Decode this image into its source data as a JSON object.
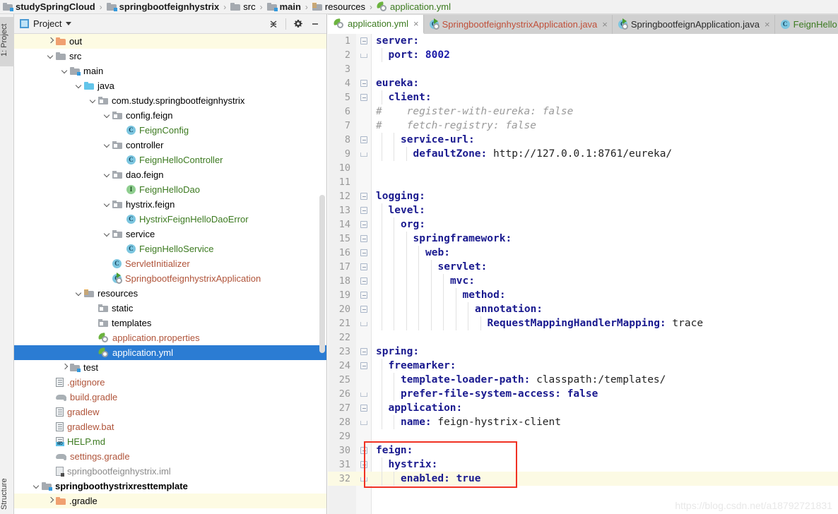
{
  "breadcrumb": {
    "items": [
      {
        "label": "studySpringCloud",
        "icon": "module-folder-icon",
        "style": "bold"
      },
      {
        "label": "springbootfeignhystrix",
        "icon": "module-folder-icon",
        "style": "bold"
      },
      {
        "label": "src",
        "icon": "folder-icon",
        "style": "normal"
      },
      {
        "label": "main",
        "icon": "source-folder-icon",
        "style": "bold"
      },
      {
        "label": "resources",
        "icon": "resources-folder-icon",
        "style": "normal"
      },
      {
        "label": "application.yml",
        "icon": "yaml-file-icon",
        "style": "green"
      }
    ]
  },
  "left_strip": {
    "project_tab": "1: Project",
    "structure_tab": "Structure"
  },
  "project_panel": {
    "title": "Project",
    "toolbar": {
      "collapse_all": "collapse-all-icon",
      "settings": "gear-icon",
      "hide": "minimize-icon"
    },
    "tree": [
      {
        "label": "out",
        "depth": 2,
        "arrow": "right",
        "icon": "folder-orange-icon",
        "color": "default",
        "state": "excluded"
      },
      {
        "label": "src",
        "depth": 2,
        "arrow": "down",
        "icon": "folder-icon",
        "color": "default"
      },
      {
        "label": "main",
        "depth": 3,
        "arrow": "down",
        "icon": "source-folder-icon",
        "color": "default"
      },
      {
        "label": "java",
        "depth": 4,
        "arrow": "down",
        "icon": "folder-blue-icon",
        "color": "default"
      },
      {
        "label": "com.study.springbootfeignhystrix",
        "depth": 5,
        "arrow": "down",
        "icon": "package-icon",
        "color": "default"
      },
      {
        "label": "config.feign",
        "depth": 6,
        "arrow": "down",
        "icon": "package-icon",
        "color": "default"
      },
      {
        "label": "FeignConfig",
        "depth": 7,
        "arrow": "none",
        "icon": "java-class-icon",
        "color": "green"
      },
      {
        "label": "controller",
        "depth": 6,
        "arrow": "down",
        "icon": "package-icon",
        "color": "default"
      },
      {
        "label": "FeignHelloController",
        "depth": 7,
        "arrow": "none",
        "icon": "java-class-icon",
        "color": "green"
      },
      {
        "label": "dao.feign",
        "depth": 6,
        "arrow": "down",
        "icon": "package-icon",
        "color": "default"
      },
      {
        "label": "FeignHelloDao",
        "depth": 7,
        "arrow": "none",
        "icon": "java-interface-icon",
        "color": "green"
      },
      {
        "label": "hystrix.feign",
        "depth": 6,
        "arrow": "down",
        "icon": "package-icon",
        "color": "default"
      },
      {
        "label": "HystrixFeignHelloDaoError",
        "depth": 7,
        "arrow": "none",
        "icon": "java-class-icon",
        "color": "green"
      },
      {
        "label": "service",
        "depth": 6,
        "arrow": "down",
        "icon": "package-icon",
        "color": "default"
      },
      {
        "label": "FeignHelloService",
        "depth": 7,
        "arrow": "none",
        "icon": "java-class-icon",
        "color": "green"
      },
      {
        "label": "ServletInitializer",
        "depth": 6,
        "arrow": "none",
        "icon": "java-class-icon",
        "color": "red"
      },
      {
        "label": "SpringbootfeignhystrixApplication",
        "depth": 6,
        "arrow": "none",
        "icon": "spring-boot-class-icon",
        "color": "red"
      },
      {
        "label": "resources",
        "depth": 4,
        "arrow": "down",
        "icon": "resources-folder-icon",
        "color": "default"
      },
      {
        "label": "static",
        "depth": 5,
        "arrow": "none",
        "icon": "package-icon",
        "color": "default"
      },
      {
        "label": "templates",
        "depth": 5,
        "arrow": "none",
        "icon": "package-icon",
        "color": "default"
      },
      {
        "label": "application.properties",
        "depth": 5,
        "arrow": "none",
        "icon": "yaml-file-icon",
        "color": "red"
      },
      {
        "label": "application.yml",
        "depth": 5,
        "arrow": "none",
        "icon": "yaml-file-icon",
        "color": "default",
        "state": "selected"
      },
      {
        "label": "test",
        "depth": 3,
        "arrow": "right",
        "icon": "source-folder-icon",
        "color": "default"
      },
      {
        "label": ".gitignore",
        "depth": 2,
        "arrow": "none",
        "icon": "text-file-icon",
        "color": "red"
      },
      {
        "label": "build.gradle",
        "depth": 2,
        "arrow": "none",
        "icon": "gradle-file-icon",
        "color": "red"
      },
      {
        "label": "gradlew",
        "depth": 2,
        "arrow": "none",
        "icon": "text-file-icon",
        "color": "red"
      },
      {
        "label": "gradlew.bat",
        "depth": 2,
        "arrow": "none",
        "icon": "text-file-icon",
        "color": "red"
      },
      {
        "label": "HELP.md",
        "depth": 2,
        "arrow": "none",
        "icon": "markdown-file-icon",
        "color": "green"
      },
      {
        "label": "settings.gradle",
        "depth": 2,
        "arrow": "none",
        "icon": "gradle-file-icon",
        "color": "red"
      },
      {
        "label": "springbootfeignhystrix.iml",
        "depth": 2,
        "arrow": "none",
        "icon": "iml-file-icon",
        "color": "grey"
      },
      {
        "label": "springboothystrixresttemplate",
        "depth": 1,
        "arrow": "down",
        "icon": "module-folder-icon",
        "color": "default",
        "bold": true
      },
      {
        "label": ".gradle",
        "depth": 2,
        "arrow": "right",
        "icon": "folder-orange-icon",
        "color": "default",
        "state": "excluded"
      }
    ]
  },
  "editor": {
    "tabs": [
      {
        "label": "application.yml",
        "icon": "yaml-file-icon",
        "color": "green",
        "active": true,
        "closable": true
      },
      {
        "label": "SpringbootfeignhystrixApplication.java",
        "icon": "spring-boot-class-icon",
        "color": "red",
        "active": false,
        "closable": true
      },
      {
        "label": "SpringbootfeignApplication.java",
        "icon": "spring-boot-class-icon",
        "color": "dark",
        "active": false,
        "closable": true
      },
      {
        "label": "FeignHello",
        "icon": "java-class-icon",
        "color": "green",
        "active": false,
        "closable": false
      }
    ],
    "file": "application.yml",
    "current_line": 32,
    "lines": [
      {
        "n": 1,
        "indent": 0,
        "tokens": [
          {
            "t": "server:",
            "c": "k"
          }
        ],
        "fold": "start"
      },
      {
        "n": 2,
        "indent": 1,
        "tokens": [
          {
            "t": "port: ",
            "c": "k"
          },
          {
            "t": "8002",
            "c": "num"
          }
        ],
        "fold": "end"
      },
      {
        "n": 3,
        "indent": 0,
        "tokens": []
      },
      {
        "n": 4,
        "indent": 0,
        "tokens": [
          {
            "t": "eureka:",
            "c": "k"
          }
        ],
        "fold": "start"
      },
      {
        "n": 5,
        "indent": 1,
        "tokens": [
          {
            "t": "client:",
            "c": "k"
          }
        ],
        "fold": "start"
      },
      {
        "n": 6,
        "indent": 0,
        "tokens": [
          {
            "t": "#    register-with-eureka: false",
            "c": "cm"
          }
        ]
      },
      {
        "n": 7,
        "indent": 0,
        "tokens": [
          {
            "t": "#    fetch-registry: false",
            "c": "cm"
          }
        ]
      },
      {
        "n": 8,
        "indent": 2,
        "tokens": [
          {
            "t": "service-url:",
            "c": "k"
          }
        ],
        "fold": "start"
      },
      {
        "n": 9,
        "indent": 3,
        "tokens": [
          {
            "t": "defaultZone: ",
            "c": "k"
          },
          {
            "t": "http://127.0.0.1:8761/eureka/",
            "c": "plain"
          }
        ],
        "fold": "end"
      },
      {
        "n": 10,
        "indent": 0,
        "tokens": []
      },
      {
        "n": 11,
        "indent": 0,
        "tokens": []
      },
      {
        "n": 12,
        "indent": 0,
        "tokens": [
          {
            "t": "logging:",
            "c": "k"
          }
        ],
        "fold": "start"
      },
      {
        "n": 13,
        "indent": 1,
        "tokens": [
          {
            "t": "level:",
            "c": "k"
          }
        ],
        "fold": "start"
      },
      {
        "n": 14,
        "indent": 2,
        "tokens": [
          {
            "t": "org:",
            "c": "k"
          }
        ],
        "fold": "start"
      },
      {
        "n": 15,
        "indent": 3,
        "tokens": [
          {
            "t": "springframework:",
            "c": "k"
          }
        ],
        "fold": "start"
      },
      {
        "n": 16,
        "indent": 4,
        "tokens": [
          {
            "t": "web:",
            "c": "k"
          }
        ],
        "fold": "start"
      },
      {
        "n": 17,
        "indent": 5,
        "tokens": [
          {
            "t": "servlet:",
            "c": "k"
          }
        ],
        "fold": "start"
      },
      {
        "n": 18,
        "indent": 6,
        "tokens": [
          {
            "t": "mvc:",
            "c": "k"
          }
        ],
        "fold": "start"
      },
      {
        "n": 19,
        "indent": 7,
        "tokens": [
          {
            "t": "method:",
            "c": "k"
          }
        ],
        "fold": "start"
      },
      {
        "n": 20,
        "indent": 8,
        "tokens": [
          {
            "t": "annotation:",
            "c": "k"
          }
        ],
        "fold": "start"
      },
      {
        "n": 21,
        "indent": 9,
        "tokens": [
          {
            "t": "RequestMappingHandlerMapping: ",
            "c": "k"
          },
          {
            "t": "trace",
            "c": "plain"
          }
        ],
        "fold": "end"
      },
      {
        "n": 22,
        "indent": 0,
        "tokens": []
      },
      {
        "n": 23,
        "indent": 0,
        "tokens": [
          {
            "t": "spring:",
            "c": "k"
          }
        ],
        "fold": "start"
      },
      {
        "n": 24,
        "indent": 1,
        "tokens": [
          {
            "t": "freemarker:",
            "c": "k"
          }
        ],
        "fold": "start"
      },
      {
        "n": 25,
        "indent": 2,
        "tokens": [
          {
            "t": "template-loader-path: ",
            "c": "k"
          },
          {
            "t": "classpath:/templates/",
            "c": "plain"
          }
        ]
      },
      {
        "n": 26,
        "indent": 2,
        "tokens": [
          {
            "t": "prefer-file-system-access: ",
            "c": "k"
          },
          {
            "t": "false",
            "c": "k"
          }
        ],
        "fold": "end"
      },
      {
        "n": 27,
        "indent": 1,
        "tokens": [
          {
            "t": "application:",
            "c": "k"
          }
        ],
        "fold": "start"
      },
      {
        "n": 28,
        "indent": 2,
        "tokens": [
          {
            "t": "name: ",
            "c": "k"
          },
          {
            "t": "feign-hystrix-client",
            "c": "plain"
          }
        ],
        "fold": "end"
      },
      {
        "n": 29,
        "indent": 0,
        "tokens": []
      },
      {
        "n": 30,
        "indent": 0,
        "tokens": [
          {
            "t": "feign:",
            "c": "k"
          }
        ],
        "fold": "start"
      },
      {
        "n": 31,
        "indent": 1,
        "tokens": [
          {
            "t": "hystrix:",
            "c": "k"
          }
        ],
        "fold": "start"
      },
      {
        "n": 32,
        "indent": 2,
        "tokens": [
          {
            "t": "enabled: ",
            "c": "k"
          },
          {
            "t": "true",
            "c": "k"
          }
        ],
        "fold": "end",
        "current": true
      }
    ],
    "highlight_box": {
      "from_line": 30,
      "to_line": 32,
      "color": "#f03123"
    }
  },
  "watermark": "https://blog.csdn.net/a18792721831"
}
